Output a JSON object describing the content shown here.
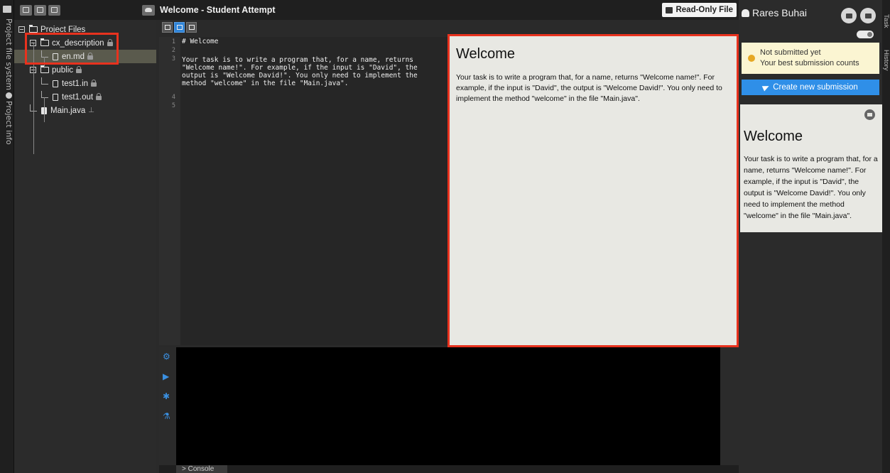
{
  "left_rail": {
    "tabs": [
      "Project file system",
      "Project info"
    ]
  },
  "tree": {
    "root": "Project Files",
    "folder_cx": "cx_description",
    "file_en": "en.md",
    "folder_public": "public",
    "file_test_in": "test1.in",
    "file_test_out": "test1.out",
    "file_main": "Main.java"
  },
  "editor": {
    "title": "Welcome - Student Attempt",
    "read_only_label": "Read-Only File",
    "line_numbers": [
      "1",
      "2",
      "3",
      "4",
      "5"
    ],
    "code_line1": "# Welcome",
    "code_line3a": "Your task is to write a program that, for a name, returns",
    "code_line3b": "\"Welcome name!\". For example, if the input is \"David\", the",
    "code_line3c": "output is \"Welcome David!\". You only need to implement the",
    "code_line3d": "method \"welcome\" in the file \"Main.java\"."
  },
  "preview": {
    "heading": "Welcome",
    "body": "Your task is to write a program that, for a name, returns \"Welcome name!\". For example, if the input is \"David\", the output is \"Welcome David!\". You only need to implement the method \"welcome\" in the file \"Main.java\"."
  },
  "bottom": {
    "console_label": "> Console"
  },
  "right_panel": {
    "user_name": "Rares Buhai",
    "notice_line1": "Not submitted yet",
    "notice_line2": "Your best submission counts",
    "submit_label": "Create new submission",
    "task_heading": "Welcome",
    "task_body": "Your task is to write a program that, for a name, returns \"Welcome name!\". For example, if the input is \"David\", the output is \"Welcome David!\". You only need to implement the method \"welcome\" in the file \"Main.java\"."
  },
  "far_rail": {
    "tabs": [
      "Task",
      "History"
    ]
  },
  "colors": {
    "accent": "#2f8fe8",
    "highlight": "#e8321e",
    "notice_bg": "#fbf5d2"
  }
}
